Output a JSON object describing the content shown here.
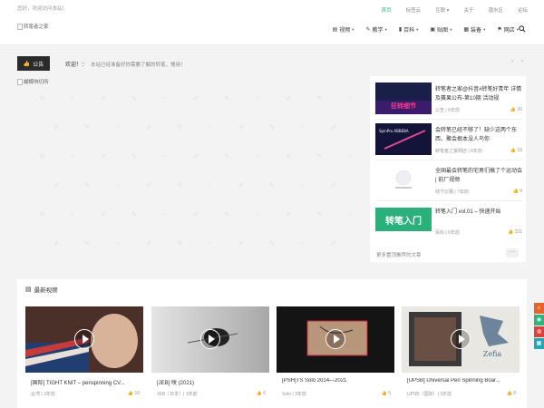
{
  "topbar": {
    "welcome": "您好，欢迎访问本站！",
    "links": [
      {
        "label": "首页",
        "active": true
      },
      {
        "label": "标签云",
        "active": false
      },
      {
        "label": "互联 ▾",
        "active": false
      },
      {
        "label": "关于",
        "active": false
      },
      {
        "label": "潜水区",
        "active": false
      },
      {
        "label": "论坛",
        "active": false
      }
    ]
  },
  "header": {
    "logo_alt": "转笔者之家",
    "nav": [
      {
        "icon": "film-icon",
        "glyph": "▤",
        "label": "视频"
      },
      {
        "icon": "pencil-icon",
        "glyph": "✎",
        "label": "教学"
      },
      {
        "icon": "book-icon",
        "glyph": "▮",
        "label": "百科"
      },
      {
        "icon": "image-icon",
        "glyph": "▣",
        "label": "贴图"
      },
      {
        "icon": "gift-icon",
        "glyph": "▦",
        "label": "装备"
      },
      {
        "icon": "flag-icon",
        "glyph": "⚑",
        "label": "网店"
      }
    ],
    "search_icon": "search-icon"
  },
  "notice": {
    "tag_label": "公告",
    "welcome": "欢迎！：",
    "text": "本站已经准备好你需要了解的转笔，慢用！"
  },
  "banner": {
    "alt": "蝴蝶响切所"
  },
  "sidebar": {
    "items": [
      {
        "title": "转笔者之家@抖音#转笔好青年 详情及赛果公布-第10期 活动规",
        "meta": "公告 | 6年前",
        "likes": "20",
        "thumb_text": "狂转细节",
        "thumb_colors": [
          "#1a1f4a",
          "#3b1c6b"
        ]
      },
      {
        "title": "会转笔已经不够了！缺少这两个东西，聚会根本没人鸟你",
        "meta": "转笔者之家网店 | 6年前",
        "likes": "19",
        "thumb_text": "SpinPro ABBEBA",
        "thumb_colors": [
          "#14143a",
          "#2a2a6e"
        ]
      },
      {
        "title": "全国最会转笔的宅男们搞了个运动会 | 前厂视频",
        "meta": "线下比赛 | 7年前",
        "likes": "9",
        "thumb_text": "",
        "thumb_colors": [
          "#ffffff",
          "#f5f5f5"
        ]
      },
      {
        "title": "转笔入门 vol.01 – 快速开始",
        "meta": "百科 | 6年前",
        "likes": "331",
        "thumb_text": "转笔入门",
        "thumb_colors": [
          "#2ab07a",
          "#34c38a"
        ]
      }
    ],
    "more_label": "更多置顶推荐的文章",
    "more_btn": "···"
  },
  "videos": {
    "section_title": "最新视频",
    "items": [
      {
        "title": "[国际] TIGHT KNIT – penspinning CV...",
        "meta": "台湾 | 3年前",
        "likes": "10",
        "bg": [
          "#5a3a2e",
          "#1d3b6a"
        ]
      },
      {
        "title": "[JEB] 咲 (2021)",
        "meta": "JEB（日本）| 3年前",
        "likes": "6",
        "bg": [
          "#d8d8d8",
          "#9a9a9a"
        ]
      },
      {
        "title": "[PSH]TS Solo 2014—2021",
        "meta": "Solo | 3年前",
        "likes": "5",
        "bg": [
          "#1a1a1a",
          "#a08060"
        ]
      },
      {
        "title": "[UPSB] Universal Pen Spinning Boar...",
        "meta": "UPSB（国际）| 3年前",
        "likes": "8",
        "bg": [
          "#e8e6e0",
          "#6a6a6a"
        ]
      }
    ]
  },
  "float_bar": [
    {
      "icon": "search-icon",
      "glyph": "⌕",
      "color": "#e8632b"
    },
    {
      "icon": "wechat-icon",
      "glyph": "◉",
      "color": "#2cb67d"
    },
    {
      "icon": "weibo-icon",
      "glyph": "◍",
      "color": "#e0403a"
    },
    {
      "icon": "qrcode-icon",
      "glyph": "▦",
      "color": "#1fa9b8"
    }
  ],
  "colors": {
    "accent": "#2cb67d",
    "dark": "#2b2b2b"
  }
}
